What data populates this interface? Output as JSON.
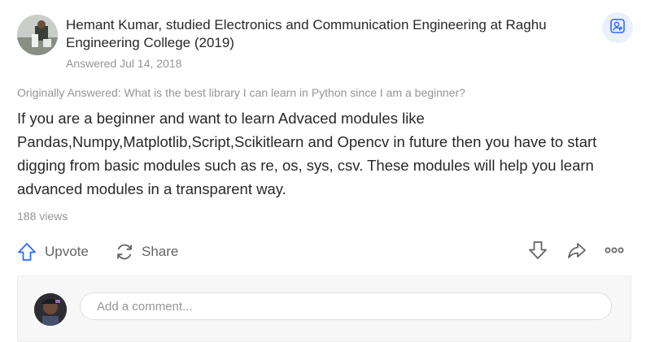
{
  "answer": {
    "author": "Hemant Kumar, studied Electronics and Communication Engineering at Raghu Engineering College (2019)",
    "answered": "Answered Jul 14, 2018",
    "originally_answered": "Originally Answered: What is the best library I can learn in Python since I am a beginner?",
    "body": "If you are a beginner and want to learn Advaced modules like Pandas,Numpy,Matplotlib,Script,Scikitlearn and Opencv in future then you have to start digging from basic modules such as re, os, sys, csv. These modules will help you learn advanced modules in a transparent way.",
    "views": "188 views"
  },
  "actions": {
    "upvote_label": "Upvote",
    "share_label": "Share"
  },
  "comment": {
    "placeholder": "Add a comment..."
  },
  "icons": {
    "follow": "person-follow-icon",
    "upvote": "upvote-arrow-icon",
    "share": "share-refresh-icon",
    "downvote": "downvote-arrow-icon",
    "forward": "forward-arrow-icon",
    "more": "more-dots-icon"
  },
  "colors": {
    "accent": "#2e69ff",
    "muted_text": "#939598",
    "body_text": "#282829",
    "action_text": "#636466",
    "follow_bg": "#ebf0ff"
  }
}
